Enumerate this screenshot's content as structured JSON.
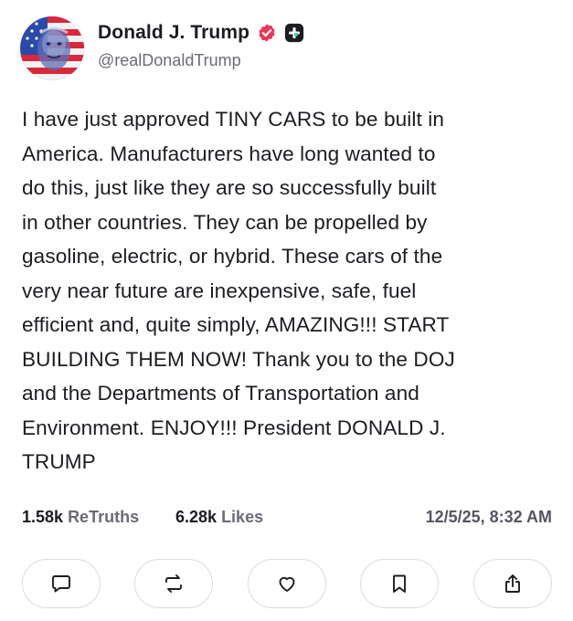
{
  "post": {
    "author": {
      "display_name": "Donald J. Trump",
      "handle": "@realDonaldTrump",
      "verified": true,
      "avatar": "avatar-flag-portrait"
    },
    "text": "I have just approved TINY CARS to be built in\nAmerica. Manufacturers have long wanted to\ndo this, just like they are so successfully built\nin other countries. They can be propelled by\ngasoline, electric, or hybrid. These cars of the\nvery near future are inexpensive, safe, fuel\nefficient and, quite simply, AMAZING!!! START\nBUILDING THEM NOW! Thank you to the DOJ\nand the Departments of Transportation and\nEnvironment. ENJOY!!! President DONALD J.\nTRUMP",
    "stats": {
      "retruths_count": "1.58k",
      "retruths_label": "ReTruths",
      "likes_count": "6.28k",
      "likes_label": "Likes"
    },
    "timestamp": "12/5/25, 8:32 AM"
  },
  "actions": [
    {
      "name": "reply",
      "icon": "comment-icon"
    },
    {
      "name": "retruth",
      "icon": "repost-icon"
    },
    {
      "name": "like",
      "icon": "heart-icon"
    },
    {
      "name": "bookmark",
      "icon": "bookmark-icon"
    },
    {
      "name": "share",
      "icon": "share-icon"
    }
  ],
  "colors": {
    "text": "#1c1c22",
    "muted": "#6b6b76",
    "verified_badge": "#e8385c",
    "border": "#dcdce2"
  }
}
